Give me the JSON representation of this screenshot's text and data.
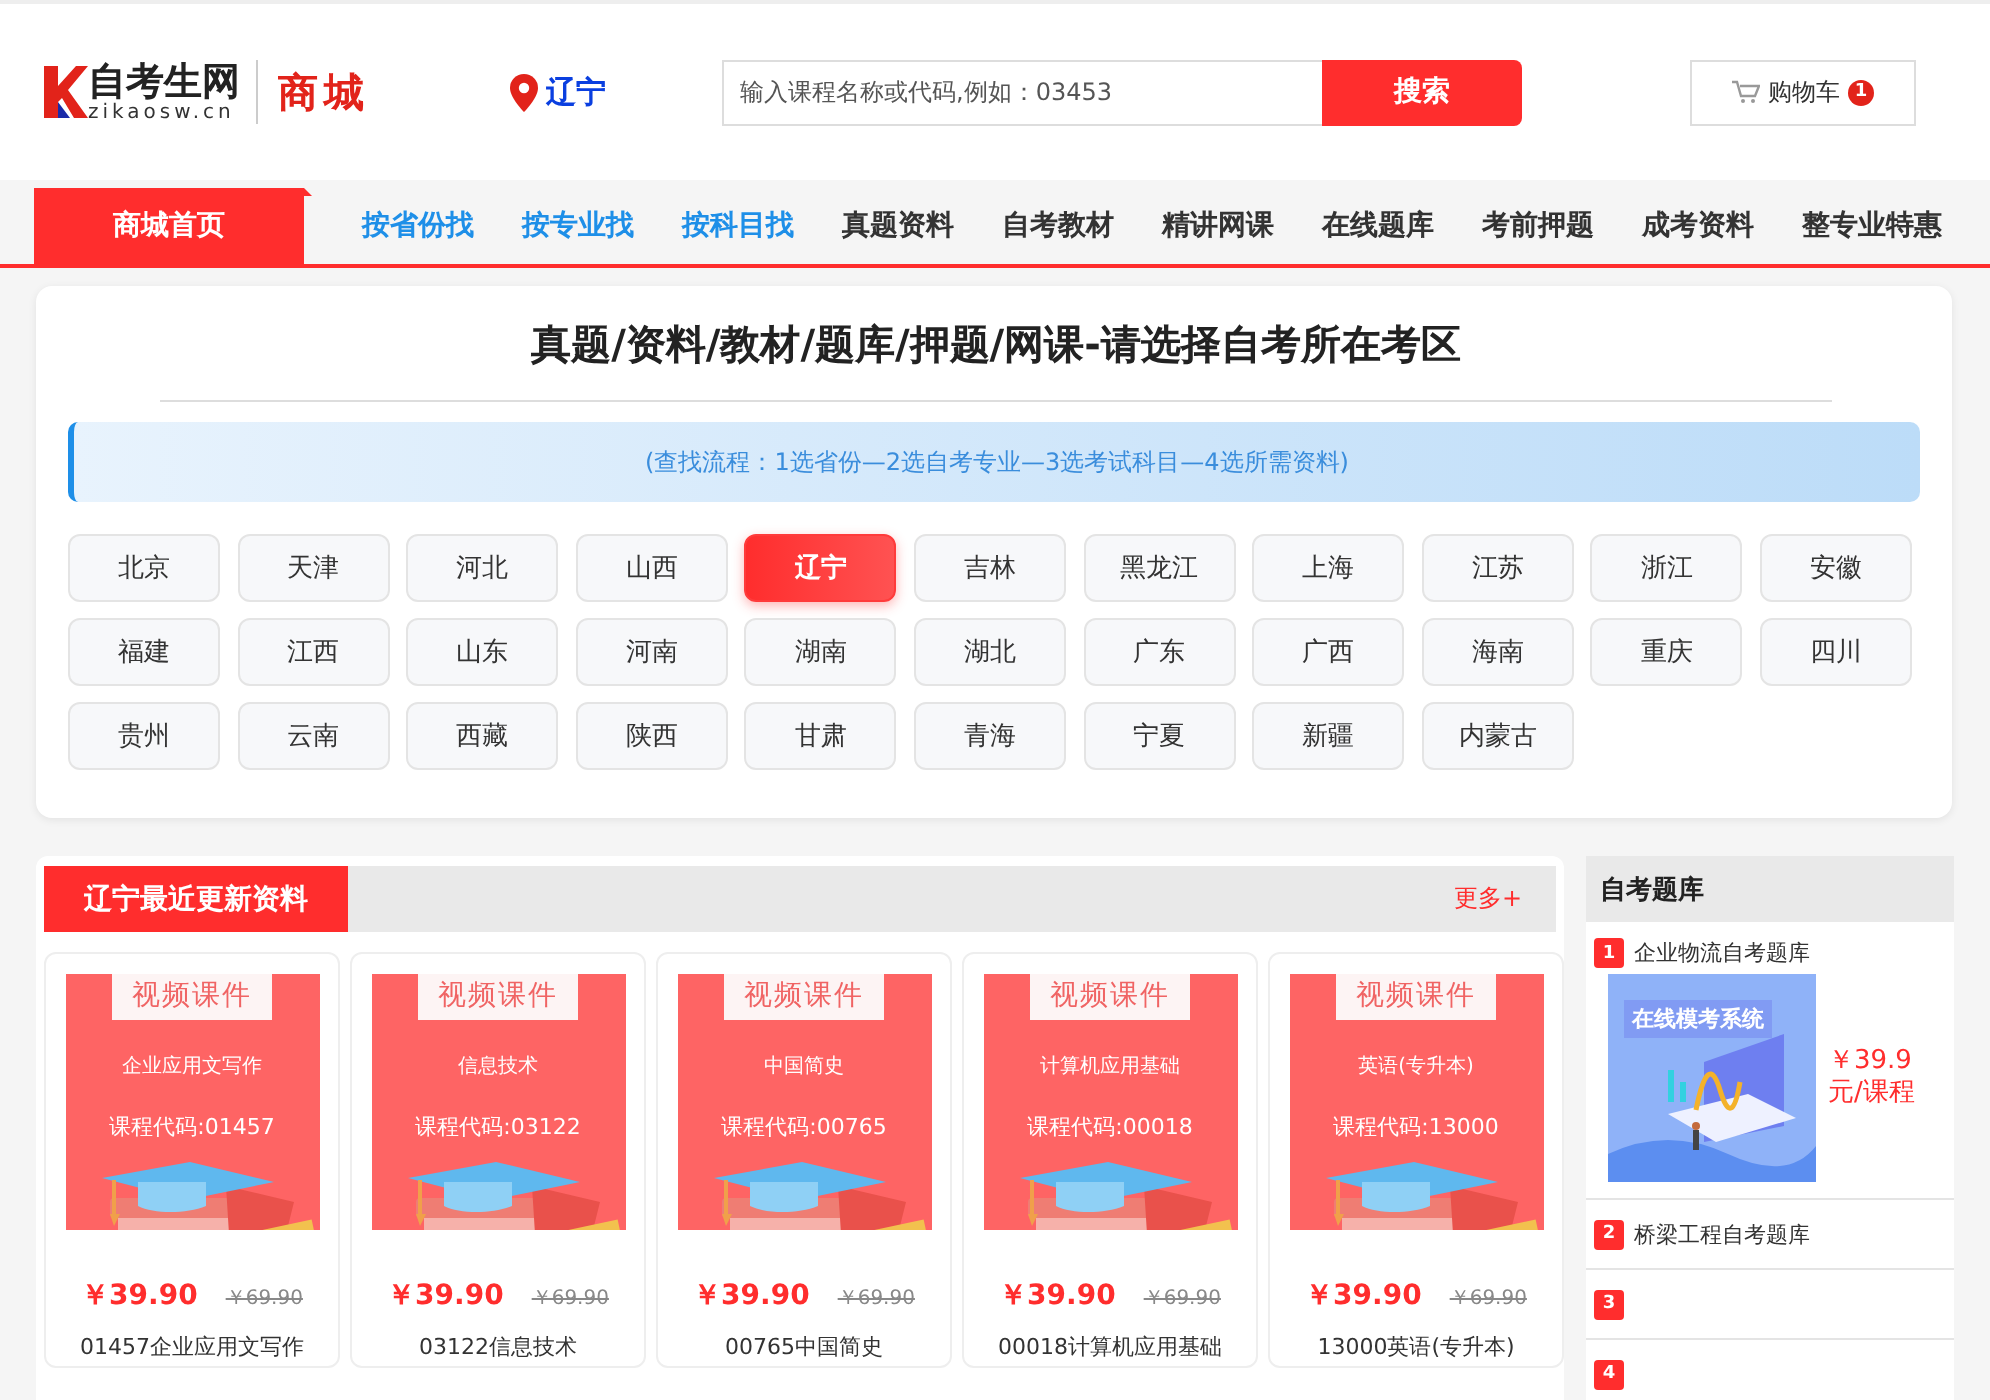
{
  "header": {
    "logo_text": "自考生网",
    "logo_domain": "zikaosw.cn",
    "mall_label": "商城",
    "location": "辽宁",
    "search": {
      "placeholder": "输入课程名称或代码,例如：03453",
      "button": "搜索"
    },
    "cart": {
      "label": "购物车",
      "count": "1"
    }
  },
  "nav": {
    "home": "商城首页",
    "items": [
      {
        "label": "按省份找",
        "kind": "finder"
      },
      {
        "label": "按专业找",
        "kind": "finder"
      },
      {
        "label": "按科目找",
        "kind": "finder"
      },
      {
        "label": "真题资料",
        "kind": "category"
      },
      {
        "label": "自考教材",
        "kind": "category"
      },
      {
        "label": "精讲网课",
        "kind": "category"
      },
      {
        "label": "在线题库",
        "kind": "category"
      },
      {
        "label": "考前押题",
        "kind": "category"
      },
      {
        "label": "成考资料",
        "kind": "category"
      },
      {
        "label": "整专业特惠",
        "kind": "category"
      }
    ]
  },
  "region_panel": {
    "title": "真题/资料/教材/题库/押题/网课-请选择自考所在考区",
    "notice": "(查找流程：1选省份—2选自考专业—3选考试科目—4选所需资料)",
    "regions": [
      {
        "label": "北京",
        "selected": false
      },
      {
        "label": "天津",
        "selected": false
      },
      {
        "label": "河北",
        "selected": false
      },
      {
        "label": "山西",
        "selected": false
      },
      {
        "label": "辽宁",
        "selected": true
      },
      {
        "label": "吉林",
        "selected": false
      },
      {
        "label": "黑龙江",
        "selected": false
      },
      {
        "label": "上海",
        "selected": false
      },
      {
        "label": "江苏",
        "selected": false
      },
      {
        "label": "浙江",
        "selected": false
      },
      {
        "label": "安徽",
        "selected": false
      },
      {
        "label": "福建",
        "selected": false
      },
      {
        "label": "江西",
        "selected": false
      },
      {
        "label": "山东",
        "selected": false
      },
      {
        "label": "河南",
        "selected": false
      },
      {
        "label": "湖南",
        "selected": false
      },
      {
        "label": "湖北",
        "selected": false
      },
      {
        "label": "广东",
        "selected": false
      },
      {
        "label": "广西",
        "selected": false
      },
      {
        "label": "海南",
        "selected": false
      },
      {
        "label": "重庆",
        "selected": false
      },
      {
        "label": "四川",
        "selected": false
      },
      {
        "label": "贵州",
        "selected": false
      },
      {
        "label": "云南",
        "selected": false
      },
      {
        "label": "西藏",
        "selected": false
      },
      {
        "label": "陕西",
        "selected": false
      },
      {
        "label": "甘肃",
        "selected": false
      },
      {
        "label": "青海",
        "selected": false
      },
      {
        "label": "宁夏",
        "selected": false
      },
      {
        "label": "新疆",
        "selected": false
      },
      {
        "label": "内蒙古",
        "selected": false
      }
    ]
  },
  "latest": {
    "title": "辽宁最近更新资料",
    "more": "更多+",
    "products": [
      {
        "cover_tag": "视频课件",
        "cover_name": "企业应用文写作",
        "cover_code": "课程代码:01457",
        "price": "￥39.90",
        "old_price": "￥69.90",
        "title": "01457企业应用文写作"
      },
      {
        "cover_tag": "视频课件",
        "cover_name": "信息技术",
        "cover_code": "课程代码:03122",
        "price": "￥39.90",
        "old_price": "￥69.90",
        "title": "03122信息技术"
      },
      {
        "cover_tag": "视频课件",
        "cover_name": "中国简史",
        "cover_code": "课程代码:00765",
        "price": "￥39.90",
        "old_price": "￥69.90",
        "title": "00765中国简史"
      },
      {
        "cover_tag": "视频课件",
        "cover_name": "计算机应用基础",
        "cover_code": "课程代码:00018",
        "price": "￥39.90",
        "old_price": "￥69.90",
        "title": "00018计算机应用基础"
      },
      {
        "cover_tag": "视频课件",
        "cover_name": "英语(专升本)",
        "cover_code": "课程代码:13000",
        "price": "￥39.90",
        "old_price": "￥69.90",
        "title": "13000英语(专升本)"
      }
    ]
  },
  "question_bank": {
    "title": "自考题库",
    "items": [
      {
        "rank": "1",
        "name": "企业物流自考题库",
        "banner": "在线模考系统",
        "price": "￥39.9",
        "unit": "元/课程"
      },
      {
        "rank": "2",
        "name": "桥梁工程自考题库"
      },
      {
        "rank": "3"
      },
      {
        "rank": "4"
      }
    ]
  }
}
